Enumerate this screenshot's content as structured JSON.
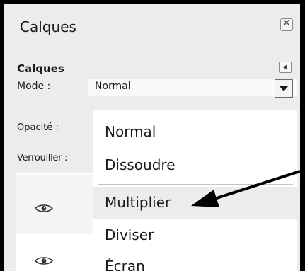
{
  "panel": {
    "title": "Calques",
    "close_icon": "close-icon"
  },
  "section": {
    "title": "Calques",
    "collapse_icon": "collapse-arrow-icon"
  },
  "fields": {
    "mode_label": "Mode :",
    "mode_value": "Normal",
    "opacity_label": "Opacité :",
    "lock_label": "Verrouiller :"
  },
  "dropdown": {
    "items": [
      {
        "label": "Normal"
      },
      {
        "label": "Dissoudre"
      },
      {
        "label": "Multiplier",
        "highlighted": true
      },
      {
        "label": "Diviser"
      },
      {
        "label": "Écran"
      }
    ]
  },
  "layers": {
    "visibility_icon": "eye-icon"
  },
  "annotation": {
    "arrow_color": "#000000"
  },
  "colors": {
    "panel_bg": "#ececec",
    "frame": "#000000",
    "highlight": "#ececec"
  }
}
